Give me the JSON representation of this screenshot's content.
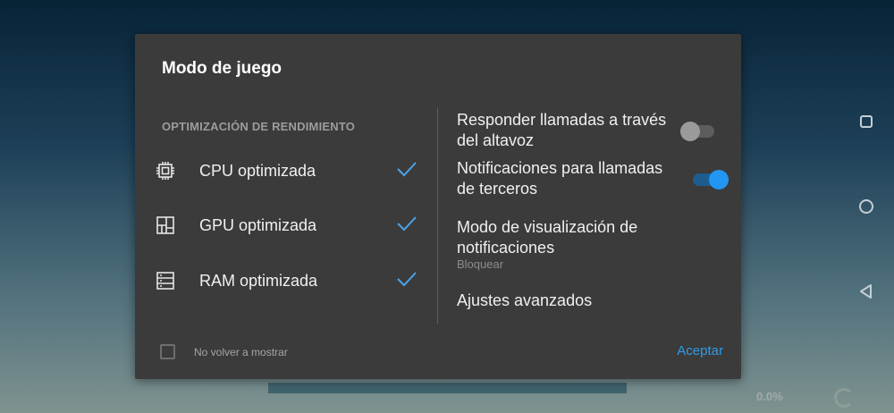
{
  "background": {
    "percent_text": "0.0%"
  },
  "navbar": {
    "icons": [
      "recents-square-icon",
      "home-circle-icon",
      "back-triangle-icon"
    ]
  },
  "dialog": {
    "title": "Modo de juego",
    "section_header": "OPTIMIZACIÓN DE RENDIMIENTO",
    "optimizations": [
      {
        "label": "CPU optimizada",
        "icon": "cpu-chip-icon",
        "checked": true
      },
      {
        "label": "GPU optimizada",
        "icon": "gpu-icon",
        "checked": true
      },
      {
        "label": "RAM optimizada",
        "icon": "ram-icon",
        "checked": true
      }
    ],
    "settings": {
      "speaker_answer": {
        "label": "Responder llamadas a través del altavoz",
        "enabled": false
      },
      "third_party_notifications": {
        "label": "Notificaciones para llamadas de terceros",
        "enabled": true
      },
      "notification_display_mode": {
        "label": "Modo de visualización de notificaciones",
        "value": "Bloquear"
      },
      "advanced": {
        "label": "Ajustes avanzados"
      }
    },
    "footer": {
      "dont_show_label": "No volver a mostrar",
      "dont_show_checked": false,
      "accept_label": "Aceptar"
    }
  },
  "colors": {
    "dialog_bg": "#3b3b3b",
    "accent": "#2196f3",
    "check": "#4aa3ea"
  }
}
